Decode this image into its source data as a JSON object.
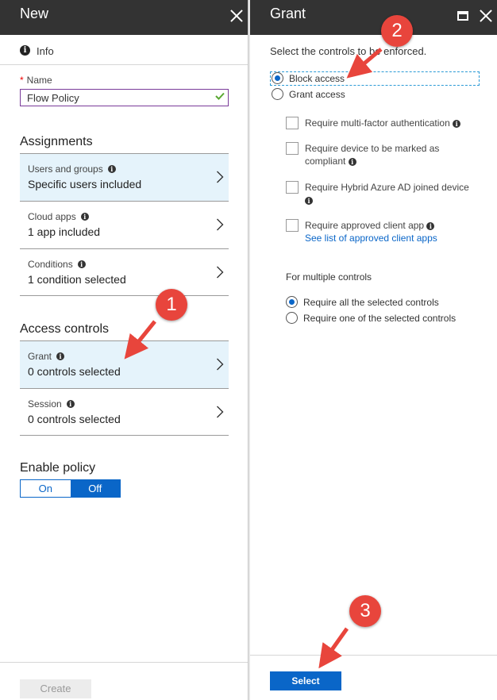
{
  "left_blade": {
    "title": "New",
    "info_label": "Info",
    "name": {
      "label": "Name",
      "required_mark": "*",
      "value": "Flow Policy"
    },
    "assignments": {
      "title": "Assignments",
      "items": [
        {
          "label": "Users and groups",
          "value": "Specific users included"
        },
        {
          "label": "Cloud apps",
          "value": "1 app included"
        },
        {
          "label": "Conditions",
          "value": "1 condition selected"
        }
      ]
    },
    "access_controls": {
      "title": "Access controls",
      "items": [
        {
          "label": "Grant",
          "value": "0 controls selected"
        },
        {
          "label": "Session",
          "value": "0 controls selected"
        }
      ]
    },
    "enable_policy": {
      "title": "Enable policy",
      "on": "On",
      "off": "Off",
      "selected": "Off"
    },
    "create_label": "Create"
  },
  "right_blade": {
    "title": "Grant",
    "instruction": "Select the controls to be enforced.",
    "options": {
      "block": "Block access",
      "grant": "Grant access",
      "selected": "block"
    },
    "checkboxes": [
      {
        "text": "Require multi-factor authentication"
      },
      {
        "text": "Require device to be marked as compliant"
      },
      {
        "text": "Require Hybrid Azure AD joined device"
      },
      {
        "text": "Require approved client app",
        "link": "See list of approved client apps"
      }
    ],
    "multiple": {
      "label": "For multiple controls",
      "require_all": "Require all the selected controls",
      "require_one": "Require one of the selected controls",
      "selected": "all"
    },
    "select_label": "Select"
  },
  "annotations": {
    "step1": "1",
    "step2": "2",
    "step3": "3",
    "accent": "#e8453c"
  }
}
